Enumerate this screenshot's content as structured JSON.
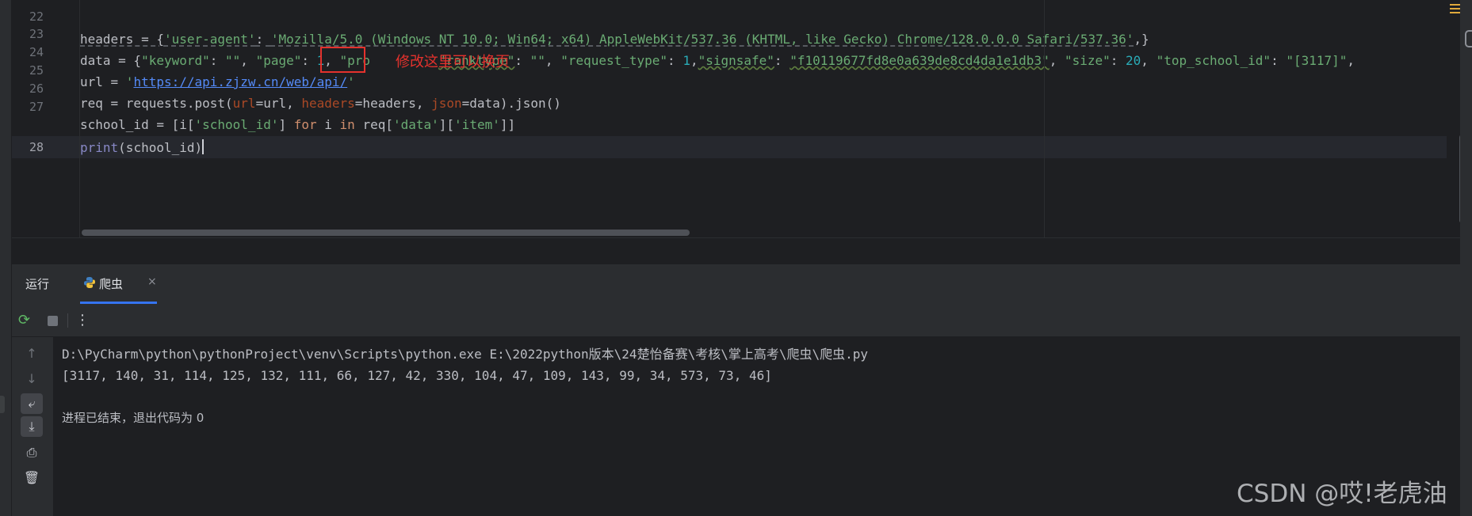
{
  "editor": {
    "line_numbers": [
      "22",
      "23",
      "24",
      "25",
      "26",
      "27",
      "28"
    ],
    "lines": {
      "l23": {
        "t1": "headers = {",
        "t2": "'user-agent'",
        "t3": ": ",
        "t4": "'Mozilla/5.0 (Windows NT 10.0; Win64; x64) AppleWebKit/537.36 (KHTML, like Gecko) Chrome/128.0.0.0 Safari/537.36'",
        "t5": ",}"
      },
      "l24": {
        "t1": "data = {",
        "t2": "\"keyword\"",
        "t3": ": ",
        "t4": "\"\"",
        "t5": ", ",
        "t6": "\"page\"",
        "t7": ": ",
        "t8": "1",
        "t9": ", ",
        "t10": "\"pro",
        "t11": "\"ranktype\"",
        "t12": ": ",
        "t13": "\"\"",
        "t14": ", ",
        "t15": "\"request_type\"",
        "t16": ": ",
        "t17": "1",
        "t18": ",",
        "t19": "\"signsafe\"",
        "t20": ": ",
        "t21": "\"f10119677fd8e0a639de8cd4da1e1db3\"",
        "t22": ", ",
        "t23": "\"size\"",
        "t24": ": ",
        "t25": "20",
        "t26": ", ",
        "t27": "\"top_school_id\"",
        "t28": ": ",
        "t29": "\"[3117]\"",
        "t30": ","
      },
      "l25": {
        "t1": "url = ",
        "t2": "'",
        "t3": "https://api.zjzw.cn/web/api/",
        "t4": "'"
      },
      "l26": {
        "t1": "req = requests.post(",
        "t2": "url",
        "t3": "=url, ",
        "t4": "headers",
        "t5": "=headers, ",
        "t6": "json",
        "t7": "=data).json()"
      },
      "l27": {
        "t1": "school_id = [i[",
        "t2": "'school_id'",
        "t3": "] ",
        "t4": "for",
        "t5": " i ",
        "t6": "in",
        "t7": " req[",
        "t8": "'data'",
        "t9": "][",
        "t10": "'item'",
        "t11": "]]"
      },
      "l28": {
        "t1": "print",
        "t2": "(school_id)"
      }
    },
    "annotation": "修改这里可以换页"
  },
  "run_panel": {
    "tab_run": "运行",
    "tab_file": "爬虫",
    "tab_close": "×",
    "console_lines": [
      "D:\\PyCharm\\python\\pythonProject\\venv\\Scripts\\python.exe E:\\2022python版本\\24楚怡备赛\\考核\\掌上高考\\爬虫\\爬虫.py",
      "[3117, 140, 31, 114, 125, 132, 111, 66, 127, 42, 330, 104, 47, 109, 143, 99, 34, 573, 73, 46]",
      "",
      "进程已结束，退出代码为 0"
    ]
  },
  "watermark": "CSDN @哎!老虎油",
  "colors": {
    "background": "#1e1f22",
    "panel": "#2b2d30",
    "keyword": "#cf8e6d",
    "string": "#6aab73",
    "number": "#2aacb8",
    "annotation_red": "#e5322d",
    "tab_underline": "#3574f0"
  },
  "icons": [
    "python-file-icon",
    "rerun-icon",
    "stop-icon",
    "more-icon",
    "scroll-up-icon",
    "scroll-down-icon",
    "soft-wrap-icon",
    "scroll-to-end-icon",
    "print-icon",
    "trash-icon",
    "hamburger-menu-icon",
    "database-icon"
  ]
}
